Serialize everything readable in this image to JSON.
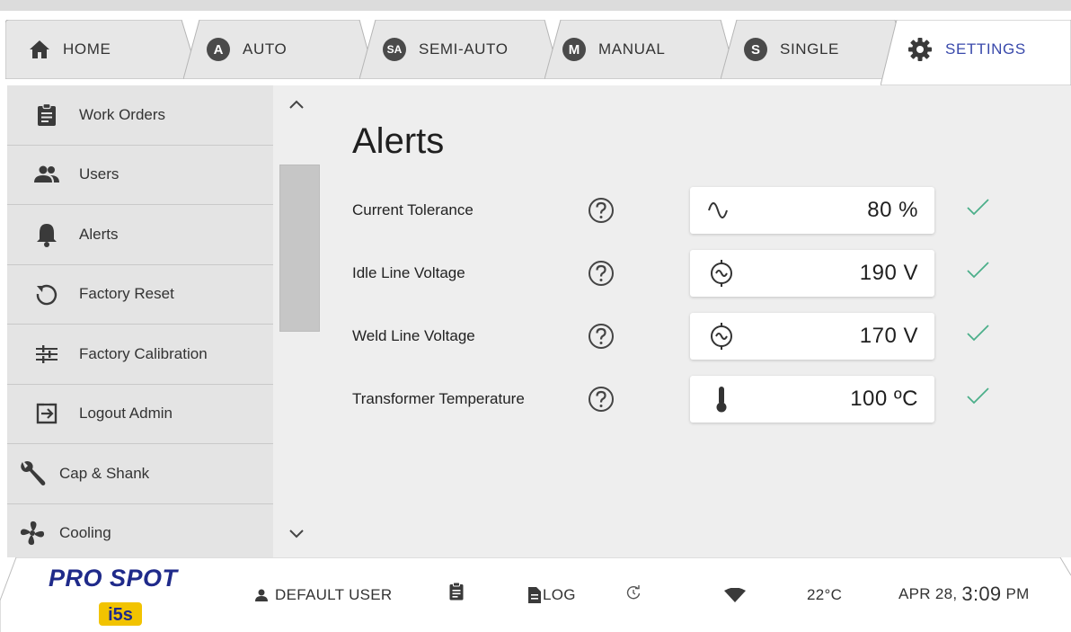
{
  "tabs": [
    {
      "label": "HOME",
      "icon": "home-icon"
    },
    {
      "label": "AUTO",
      "badge": "A"
    },
    {
      "label": "SEMI-AUTO",
      "badge": "SA"
    },
    {
      "label": "MANUAL",
      "badge": "M"
    },
    {
      "label": "SINGLE",
      "badge": "S"
    },
    {
      "label": "SETTINGS",
      "icon": "gear-icon",
      "active": true
    }
  ],
  "sidebar": {
    "items": [
      {
        "label": "Work Orders",
        "icon": "clipboard-icon"
      },
      {
        "label": "Users",
        "icon": "users-icon"
      },
      {
        "label": "Alerts",
        "icon": "bell-icon"
      },
      {
        "label": "Factory Reset",
        "icon": "reset-icon"
      },
      {
        "label": "Factory Calibration",
        "icon": "sliders-icon"
      },
      {
        "label": "Logout Admin",
        "icon": "logout-icon"
      },
      {
        "label": "Cap & Shank",
        "icon": "wrench-icon"
      },
      {
        "label": "Cooling",
        "icon": "fan-icon"
      }
    ]
  },
  "main": {
    "title": "Alerts",
    "rows": [
      {
        "label": "Current Tolerance",
        "value": "80 %",
        "icon": "sine-wave-icon"
      },
      {
        "label": "Idle Line Voltage",
        "value": "190 V",
        "icon": "ac-voltage-icon"
      },
      {
        "label": "Weld Line Voltage",
        "value": "170 V",
        "icon": "ac-voltage-icon"
      },
      {
        "label": "Transformer Temperature",
        "value": "100 ºC",
        "icon": "thermometer-icon"
      }
    ]
  },
  "footer": {
    "logo_text": "PRO SPOT",
    "logo_sub": "i5s",
    "user": "DEFAULT USER",
    "log": "LOG",
    "temperature": "22°C",
    "date": "APR 28,",
    "time": "3:09",
    "ampm": "PM"
  },
  "colors": {
    "accent": "#3949ab",
    "check": "#4caf8a",
    "logo_blue": "#1f2a8a",
    "logo_red": "#e53935",
    "logo_yellow": "#f2c300"
  }
}
